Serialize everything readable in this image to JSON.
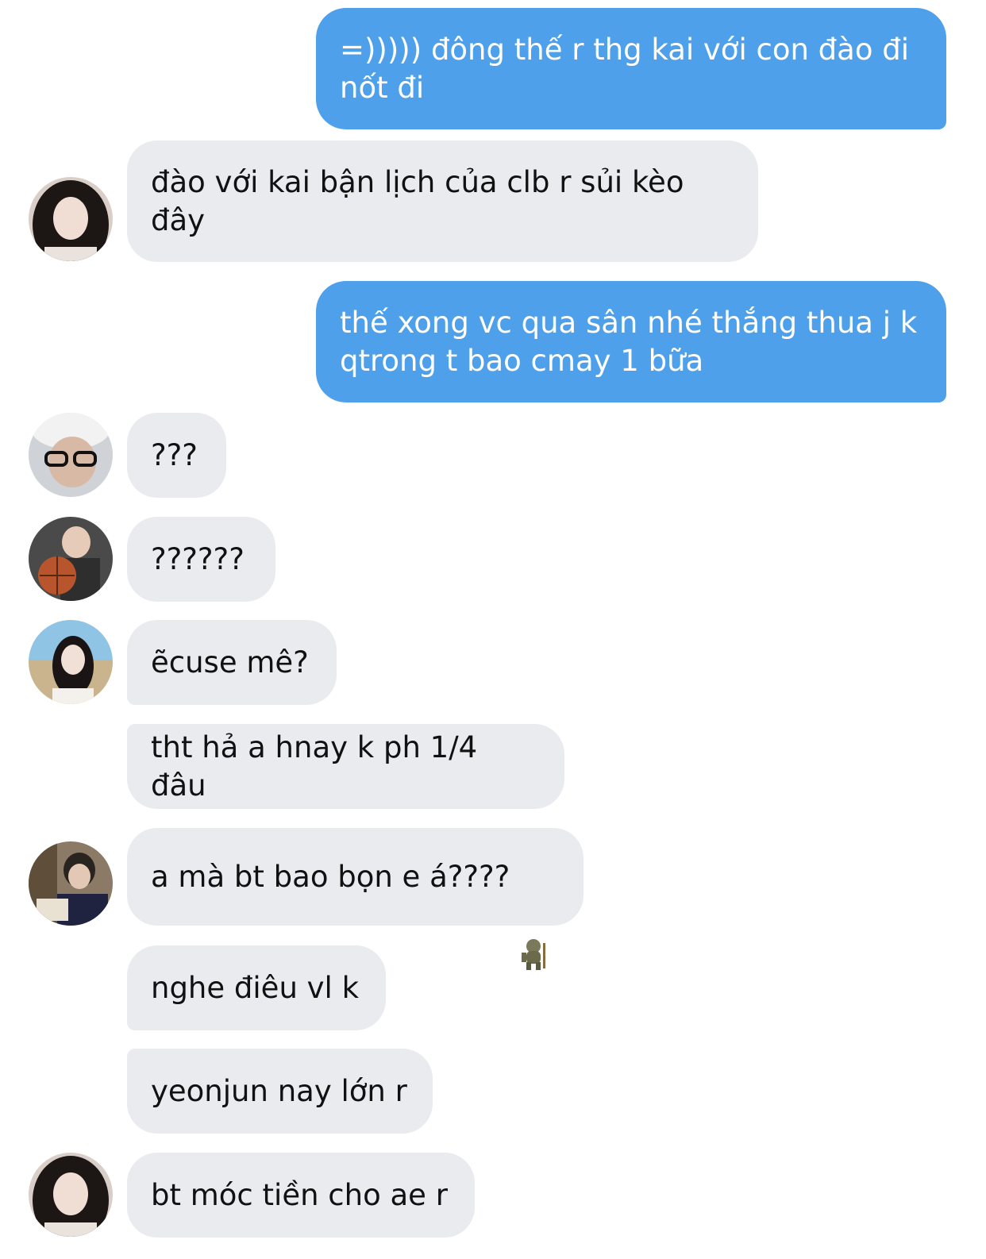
{
  "messages": [
    {
      "side": "out",
      "text": "=))))) đông thế r thg kai với con đào đi\nnốt đi"
    },
    {
      "side": "in",
      "text": "đào với kai bận lịch của clb r sủi kèo\nđây",
      "avatar": "avatar-girl-dark-hair-icon"
    },
    {
      "side": "out",
      "text": "thế xong vc qua sân nhé thắng thua j k\nqtrong t bao cmay 1 bữa"
    },
    {
      "side": "in",
      "text": "???",
      "avatar": "avatar-boy-glasses-icon"
    },
    {
      "side": "in",
      "text": "??????",
      "avatar": "avatar-boy-basketball-icon"
    },
    {
      "side": "in",
      "text": "ẽcuse mê?",
      "avatar": "avatar-girl-beach-icon"
    },
    {
      "side": "in",
      "text": "tht hả a hnay k ph 1/4 đâu"
    },
    {
      "side": "in",
      "text": "a mà bt bao bọn e á????",
      "avatar": "avatar-boy-reading-icon",
      "emoji": "troll-emoji-icon"
    },
    {
      "side": "in",
      "text": "nghe điêu vl k"
    },
    {
      "side": "in",
      "text": "yeonjun nay lớn r"
    },
    {
      "side": "in",
      "text": "bt móc tiền cho ae r",
      "avatar": "avatar-girl-dark-hair-icon"
    }
  ],
  "colors": {
    "outgoing": "#4fa0ea",
    "incoming": "#e9ebee"
  }
}
